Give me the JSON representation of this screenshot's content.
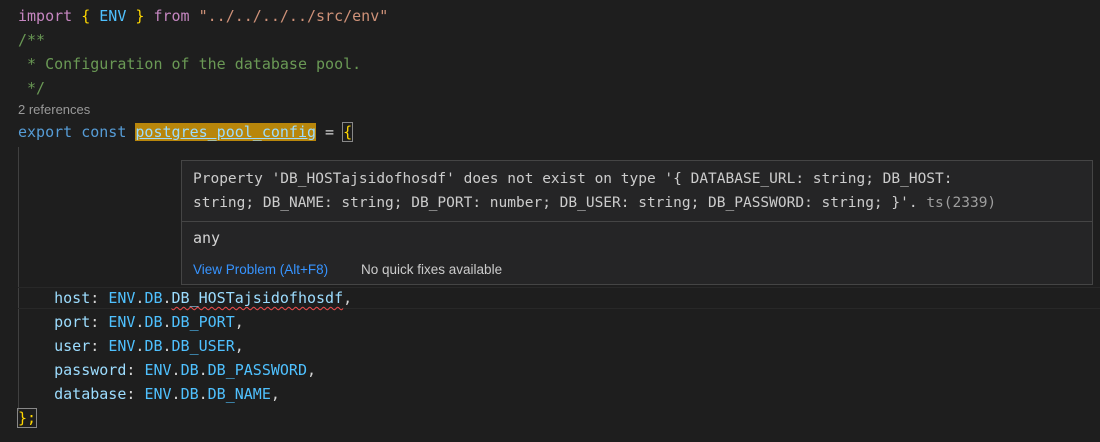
{
  "code": {
    "line1": {
      "kw_import": "import",
      "brace_open": "{",
      "env": "ENV",
      "brace_close": "}",
      "kw_from": "from",
      "path": "\"../../../../src/env\""
    },
    "comment": {
      "open": "/**",
      "body": " * Configuration of the database pool.",
      "close": " */"
    },
    "codelens": "2 references",
    "decl": {
      "kw_export": "export",
      "kw_const": "const",
      "name": "postgres_pool_config",
      "eq": " = ",
      "brace_open": "{"
    },
    "fields": [
      {
        "key": "host",
        "obj": "ENV",
        "ns": "DB",
        "prop": "DB_HOSTajsidofhosdf"
      },
      {
        "key": "port",
        "obj": "ENV",
        "ns": "DB",
        "prop": "DB_PORT"
      },
      {
        "key": "user",
        "obj": "ENV",
        "ns": "DB",
        "prop": "DB_USER"
      },
      {
        "key": "password",
        "obj": "ENV",
        "ns": "DB",
        "prop": "DB_PASSWORD"
      },
      {
        "key": "database",
        "obj": "ENV",
        "ns": "DB",
        "prop": "DB_NAME"
      }
    ],
    "closing": "};"
  },
  "hover": {
    "message_line1": "Property 'DB_HOSTajsidofhosdf' does not exist on type '{ DATABASE_URL: string; DB_HOST:",
    "message_line2": "string; DB_NAME: string; DB_PORT: number; DB_USER: string; DB_PASSWORD: string; }'.",
    "error_code": "ts(2339)",
    "type_info": "any",
    "view_problem": "View Problem (Alt+F8)",
    "no_fixes": "No quick fixes available"
  },
  "colors": {
    "background": "#1e1e1e",
    "keyword_control": "#c586c0",
    "keyword": "#569cd6",
    "string": "#ce9178",
    "comment": "#6a9955",
    "property": "#9cdcfe",
    "constant": "#4fc1ff",
    "error_squiggle": "#f14c4c",
    "link": "#3794ff"
  }
}
